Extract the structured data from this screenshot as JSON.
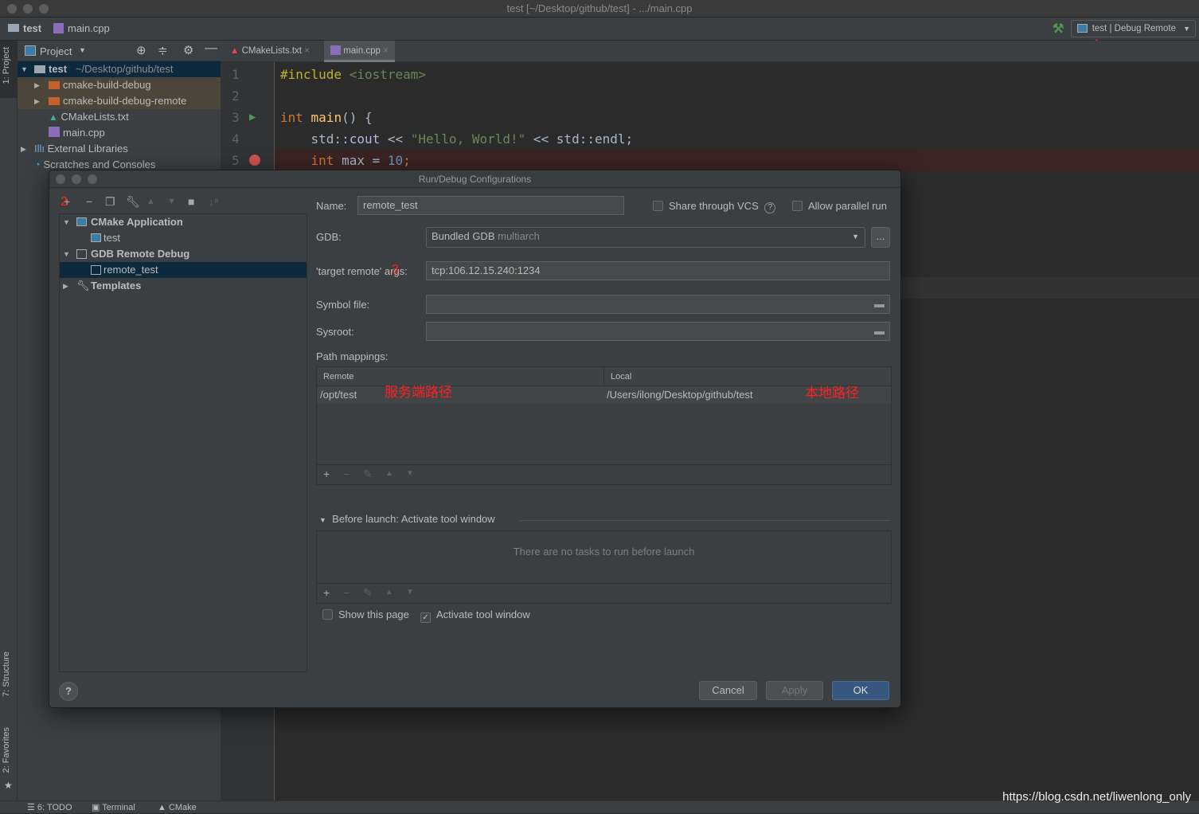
{
  "window": {
    "title": "test [~/Desktop/github/test] - .../main.cpp"
  },
  "breadcrumb": {
    "project": "test",
    "file": "main.cpp"
  },
  "run_config": {
    "label": "test | Debug Remote",
    "annotation": "1"
  },
  "left_stripe": {
    "project": "1: Project",
    "structure": "7: Structure",
    "favorites": "2: Favorites"
  },
  "project_panel": {
    "title": "Project",
    "tree": [
      {
        "label": "test",
        "path": "~/Desktop/github/test"
      },
      {
        "label": "cmake-build-debug"
      },
      {
        "label": "cmake-build-debug-remote"
      },
      {
        "label": "CMakeLists.txt"
      },
      {
        "label": "main.cpp"
      },
      {
        "label": "External Libraries"
      },
      {
        "label": "Scratches and Consoles"
      }
    ]
  },
  "editor": {
    "tabs": [
      {
        "label": "CMakeLists.txt"
      },
      {
        "label": "main.cpp"
      }
    ],
    "lines": [
      {
        "n": "1"
      },
      {
        "n": "2"
      },
      {
        "n": "3"
      },
      {
        "n": "4"
      },
      {
        "n": "5"
      }
    ],
    "code": {
      "l1a": "#include",
      "l1b": " <iostream>",
      "l3a": "int",
      "l3b": " main",
      "l3c": "() {",
      "l4a": "    std::",
      "l4b": "cout",
      "l4c": " << ",
      "l4d": "\"Hello, World!\"",
      "l4e": " << std::endl;",
      "l5a": "    int",
      "l5b": " max = ",
      "l5c": "10",
      "l5d": ";"
    }
  },
  "dialog": {
    "title": "Run/Debug Configurations",
    "annotation2": "2",
    "annotation3": "3",
    "tree": [
      {
        "label": "CMake Application"
      },
      {
        "label": "test"
      },
      {
        "label": "GDB Remote Debug"
      },
      {
        "label": "remote_test"
      },
      {
        "label": "Templates"
      }
    ],
    "name_label": "Name:",
    "name_value": "remote_test",
    "share_vcs": "Share through VCS",
    "share_vcs_checked": false,
    "allow_parallel": "Allow parallel run",
    "allow_parallel_checked": false,
    "gdb_label": "GDB:",
    "gdb_value": "Bundled GDB",
    "gdb_hint": "multiarch",
    "browse": "...",
    "target_label": "'target remote' args:",
    "target_value": "tcp:106.12.15.240:1234",
    "symbol_label": "Symbol file:",
    "symbol_value": "",
    "sysroot_label": "Sysroot:",
    "sysroot_value": "",
    "path_mappings_label": "Path mappings:",
    "mapping_columns": [
      "Remote",
      "Local"
    ],
    "mappings": [
      {
        "remote": "/opt/test",
        "local": "/Users/ilong/Desktop/github/test"
      }
    ],
    "remote_note": "服务端路径",
    "local_note": "本地路径",
    "before_launch": "Before launch: Activate tool window",
    "no_tasks": "There are no tasks to run before launch",
    "show_page": "Show this page",
    "show_page_checked": false,
    "activate_tool": "Activate tool window",
    "activate_tool_checked": true,
    "cancel": "Cancel",
    "apply": "Apply",
    "ok": "OK",
    "help": "?"
  },
  "bottom_bar": {
    "todo": "6: TODO",
    "terminal": "Terminal",
    "cmake": "CMake"
  },
  "watermark": "https://blog.csdn.net/liwenlong_only",
  "colors": {
    "accent": "#365880",
    "selection": "#0d293e",
    "annotation": "#ff2020",
    "breakpoint": "#c75450"
  }
}
